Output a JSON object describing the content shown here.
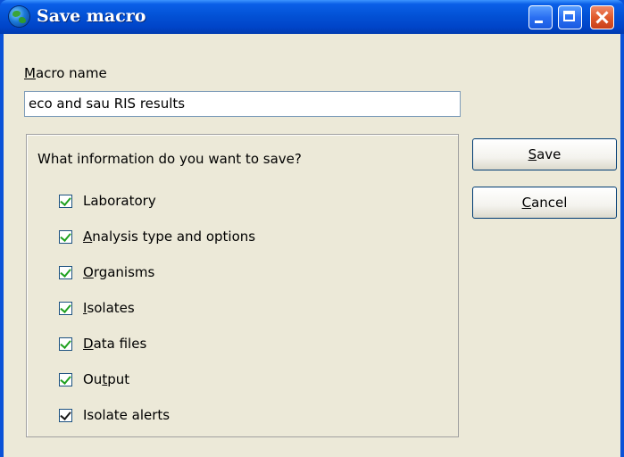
{
  "window": {
    "title": "Save macro",
    "icon": "globe-icon",
    "controls": [
      "minimize-icon",
      "maximize-icon",
      "close-icon"
    ]
  },
  "macro_name": {
    "label_first": "M",
    "label_rest": "acro name",
    "value": "eco and sau RIS results"
  },
  "group": {
    "title": "What information do you want to save?",
    "items": [
      {
        "pre": "",
        "acc": "",
        "rest": "Laboratory",
        "checked": true
      },
      {
        "pre": "",
        "acc": "A",
        "rest": "nalysis type and options",
        "checked": true
      },
      {
        "pre": "",
        "acc": "O",
        "rest": "rganisms",
        "checked": true
      },
      {
        "pre": "",
        "acc": "I",
        "rest": "solates",
        "checked": true
      },
      {
        "pre": "",
        "acc": "D",
        "rest": "ata files",
        "checked": true
      },
      {
        "pre": "Ou",
        "acc": "t",
        "rest": "put",
        "checked": true
      },
      {
        "pre": "",
        "acc": "",
        "rest": "Isolate alerts",
        "checked": true
      }
    ]
  },
  "buttons": {
    "save": {
      "acc": "S",
      "rest": "ave"
    },
    "cancel": {
      "acc": "C",
      "rest": "ancel"
    }
  },
  "colors": {
    "titlebar": "#0044c8",
    "face": "#ece9d8",
    "check": "#21a121"
  }
}
